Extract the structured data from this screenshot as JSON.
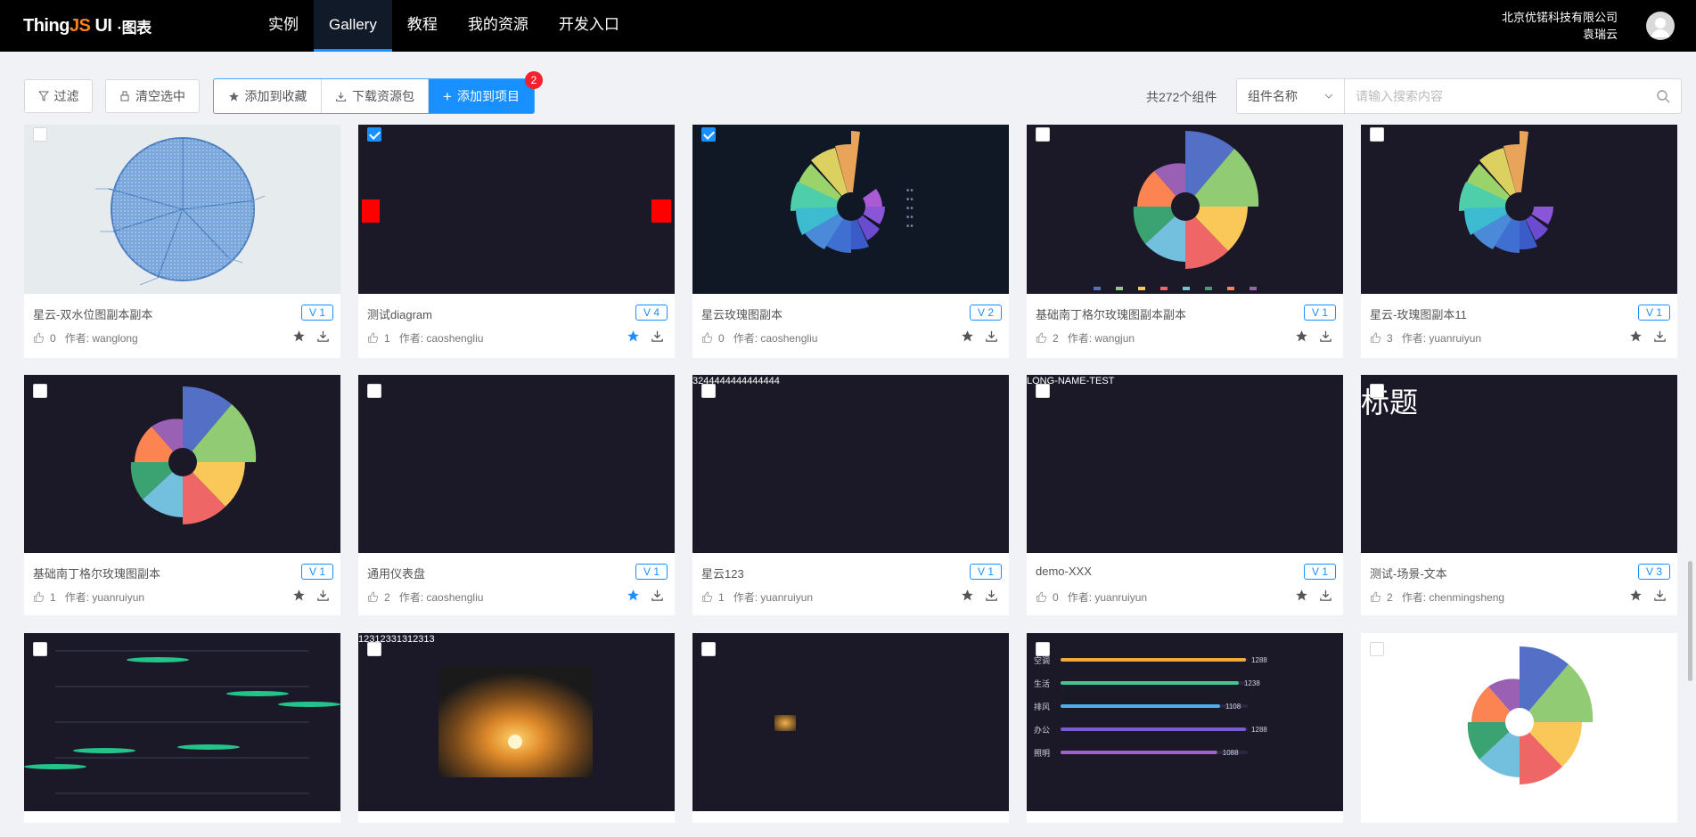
{
  "header": {
    "logo": {
      "thing": "Thing",
      "js": "JS",
      "ui": "UI",
      "sub": "·图表"
    },
    "nav": [
      {
        "label": "实例"
      },
      {
        "label": "Gallery"
      },
      {
        "label": "教程"
      },
      {
        "label": "我的资源"
      },
      {
        "label": "开发入口"
      }
    ],
    "company": "北京优锘科技有限公司",
    "user": "袁瑞云"
  },
  "toolbar": {
    "filter_label": "过滤",
    "clear_label": "清空选中",
    "favorite_label": "添加到收藏",
    "download_label": "下载资源包",
    "add_project_label": "添加到项目",
    "badge_count": "2",
    "total_label": "共272个组件",
    "search_field": "组件名称",
    "search_placeholder": "请输入搜索内容"
  },
  "cards": [
    {
      "title": "星云-双水位图副本副本",
      "version": "V 1",
      "likes": "0",
      "author": "作者: wanglong",
      "checked": false,
      "starred": false
    },
    {
      "title": "测试diagram",
      "version": "V 4",
      "likes": "1",
      "author": "作者: caoshengliu",
      "checked": true,
      "starred": true
    },
    {
      "title": "星云玫瑰图副本",
      "version": "V 2",
      "likes": "0",
      "author": "作者: caoshengliu",
      "checked": true,
      "starred": false
    },
    {
      "title": "基础南丁格尔玫瑰图副本副本",
      "version": "V 1",
      "likes": "2",
      "author": "作者: wangjun",
      "checked": false,
      "starred": false
    },
    {
      "title": "星云-玫瑰图副本11",
      "version": "V 1",
      "likes": "3",
      "author": "作者: yuanruiyun",
      "checked": false,
      "starred": false
    },
    {
      "title": "基础南丁格尔玫瑰图副本",
      "version": "V 1",
      "likes": "1",
      "author": "作者: yuanruiyun",
      "checked": false,
      "starred": false
    },
    {
      "title": "通用仪表盘",
      "version": "V 1",
      "likes": "2",
      "author": "作者: caoshengliu",
      "checked": false,
      "starred": true
    },
    {
      "title": "星云123",
      "version": "V 1",
      "likes": "1",
      "author": "作者: yuanruiyun",
      "checked": false,
      "starred": false,
      "overlay": "3244444444444444"
    },
    {
      "title": "demo-XXX",
      "version": "V 1",
      "likes": "0",
      "author": "作者: yuanruiyun",
      "checked": false,
      "starred": false,
      "overlay": "LONG-NAME-TEST"
    },
    {
      "title": "测试-场景-文本",
      "version": "V 3",
      "likes": "2",
      "author": "作者: chenmingsheng",
      "checked": false,
      "starred": false,
      "overlay": "标题"
    },
    {
      "title": "",
      "version": "",
      "likes": "",
      "author": "",
      "checked": false,
      "starred": false
    },
    {
      "title": "",
      "version": "",
      "likes": "",
      "author": "",
      "checked": false,
      "starred": false,
      "overlay": "12312331312313"
    },
    {
      "title": "",
      "version": "",
      "likes": "",
      "author": "",
      "checked": false,
      "starred": false
    },
    {
      "title": "",
      "version": "",
      "likes": "",
      "author": "",
      "checked": false,
      "starred": false
    },
    {
      "title": "",
      "version": "",
      "likes": "",
      "author": "",
      "checked": false,
      "starred": false
    }
  ],
  "bar_thumb": {
    "labels": [
      "空调",
      "生活",
      "排风",
      "办公",
      "照明"
    ],
    "values": [
      "1288",
      "1238",
      "1108",
      "1288",
      "1088"
    ],
    "colors": [
      "#f5a742",
      "#3ec98e",
      "#4ab0e8",
      "#7b5bd6",
      "#a75fd0"
    ]
  },
  "colors": {
    "primary": "#1890ff",
    "header_bg": "#000000",
    "badge": "#f5222d",
    "logo_accent": "#f5821f"
  }
}
